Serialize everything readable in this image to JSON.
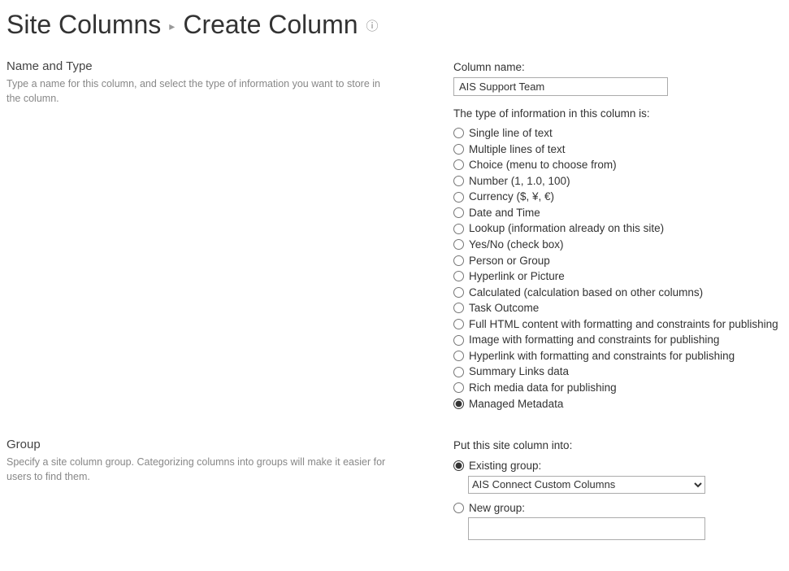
{
  "breadcrumb": {
    "site_columns": "Site Columns",
    "sep": "▸",
    "create_column": "Create Column",
    "info_glyph": "ⓘ"
  },
  "name_type": {
    "title": "Name and Type",
    "desc": "Type a name for this column, and select the type of information you want to store in the column.",
    "column_name_label": "Column name:",
    "column_name_value": "AIS Support Team",
    "info_type_label": "The type of information in this column is:",
    "options": [
      {
        "label": "Single line of text",
        "selected": false
      },
      {
        "label": "Multiple lines of text",
        "selected": false
      },
      {
        "label": "Choice (menu to choose from)",
        "selected": false
      },
      {
        "label": "Number (1, 1.0, 100)",
        "selected": false
      },
      {
        "label": "Currency ($, ¥, €)",
        "selected": false
      },
      {
        "label": "Date and Time",
        "selected": false
      },
      {
        "label": "Lookup (information already on this site)",
        "selected": false
      },
      {
        "label": "Yes/No (check box)",
        "selected": false
      },
      {
        "label": "Person or Group",
        "selected": false
      },
      {
        "label": "Hyperlink or Picture",
        "selected": false
      },
      {
        "label": "Calculated (calculation based on other columns)",
        "selected": false
      },
      {
        "label": "Task Outcome",
        "selected": false
      },
      {
        "label": "Full HTML content with formatting and constraints for publishing",
        "selected": false
      },
      {
        "label": "Image with formatting and constraints for publishing",
        "selected": false
      },
      {
        "label": "Hyperlink with formatting and constraints for publishing",
        "selected": false
      },
      {
        "label": "Summary Links data",
        "selected": false
      },
      {
        "label": "Rich media data for publishing",
        "selected": false
      },
      {
        "label": "Managed Metadata",
        "selected": true
      }
    ]
  },
  "group": {
    "title": "Group",
    "desc": "Specify a site column group. Categorizing columns into groups will make it easier for users to find them.",
    "put_into_label": "Put this site column into:",
    "existing_label": "Existing group:",
    "existing_selected": true,
    "existing_value": "AIS Connect Custom Columns",
    "new_label": "New group:",
    "new_selected": false,
    "new_value": ""
  }
}
